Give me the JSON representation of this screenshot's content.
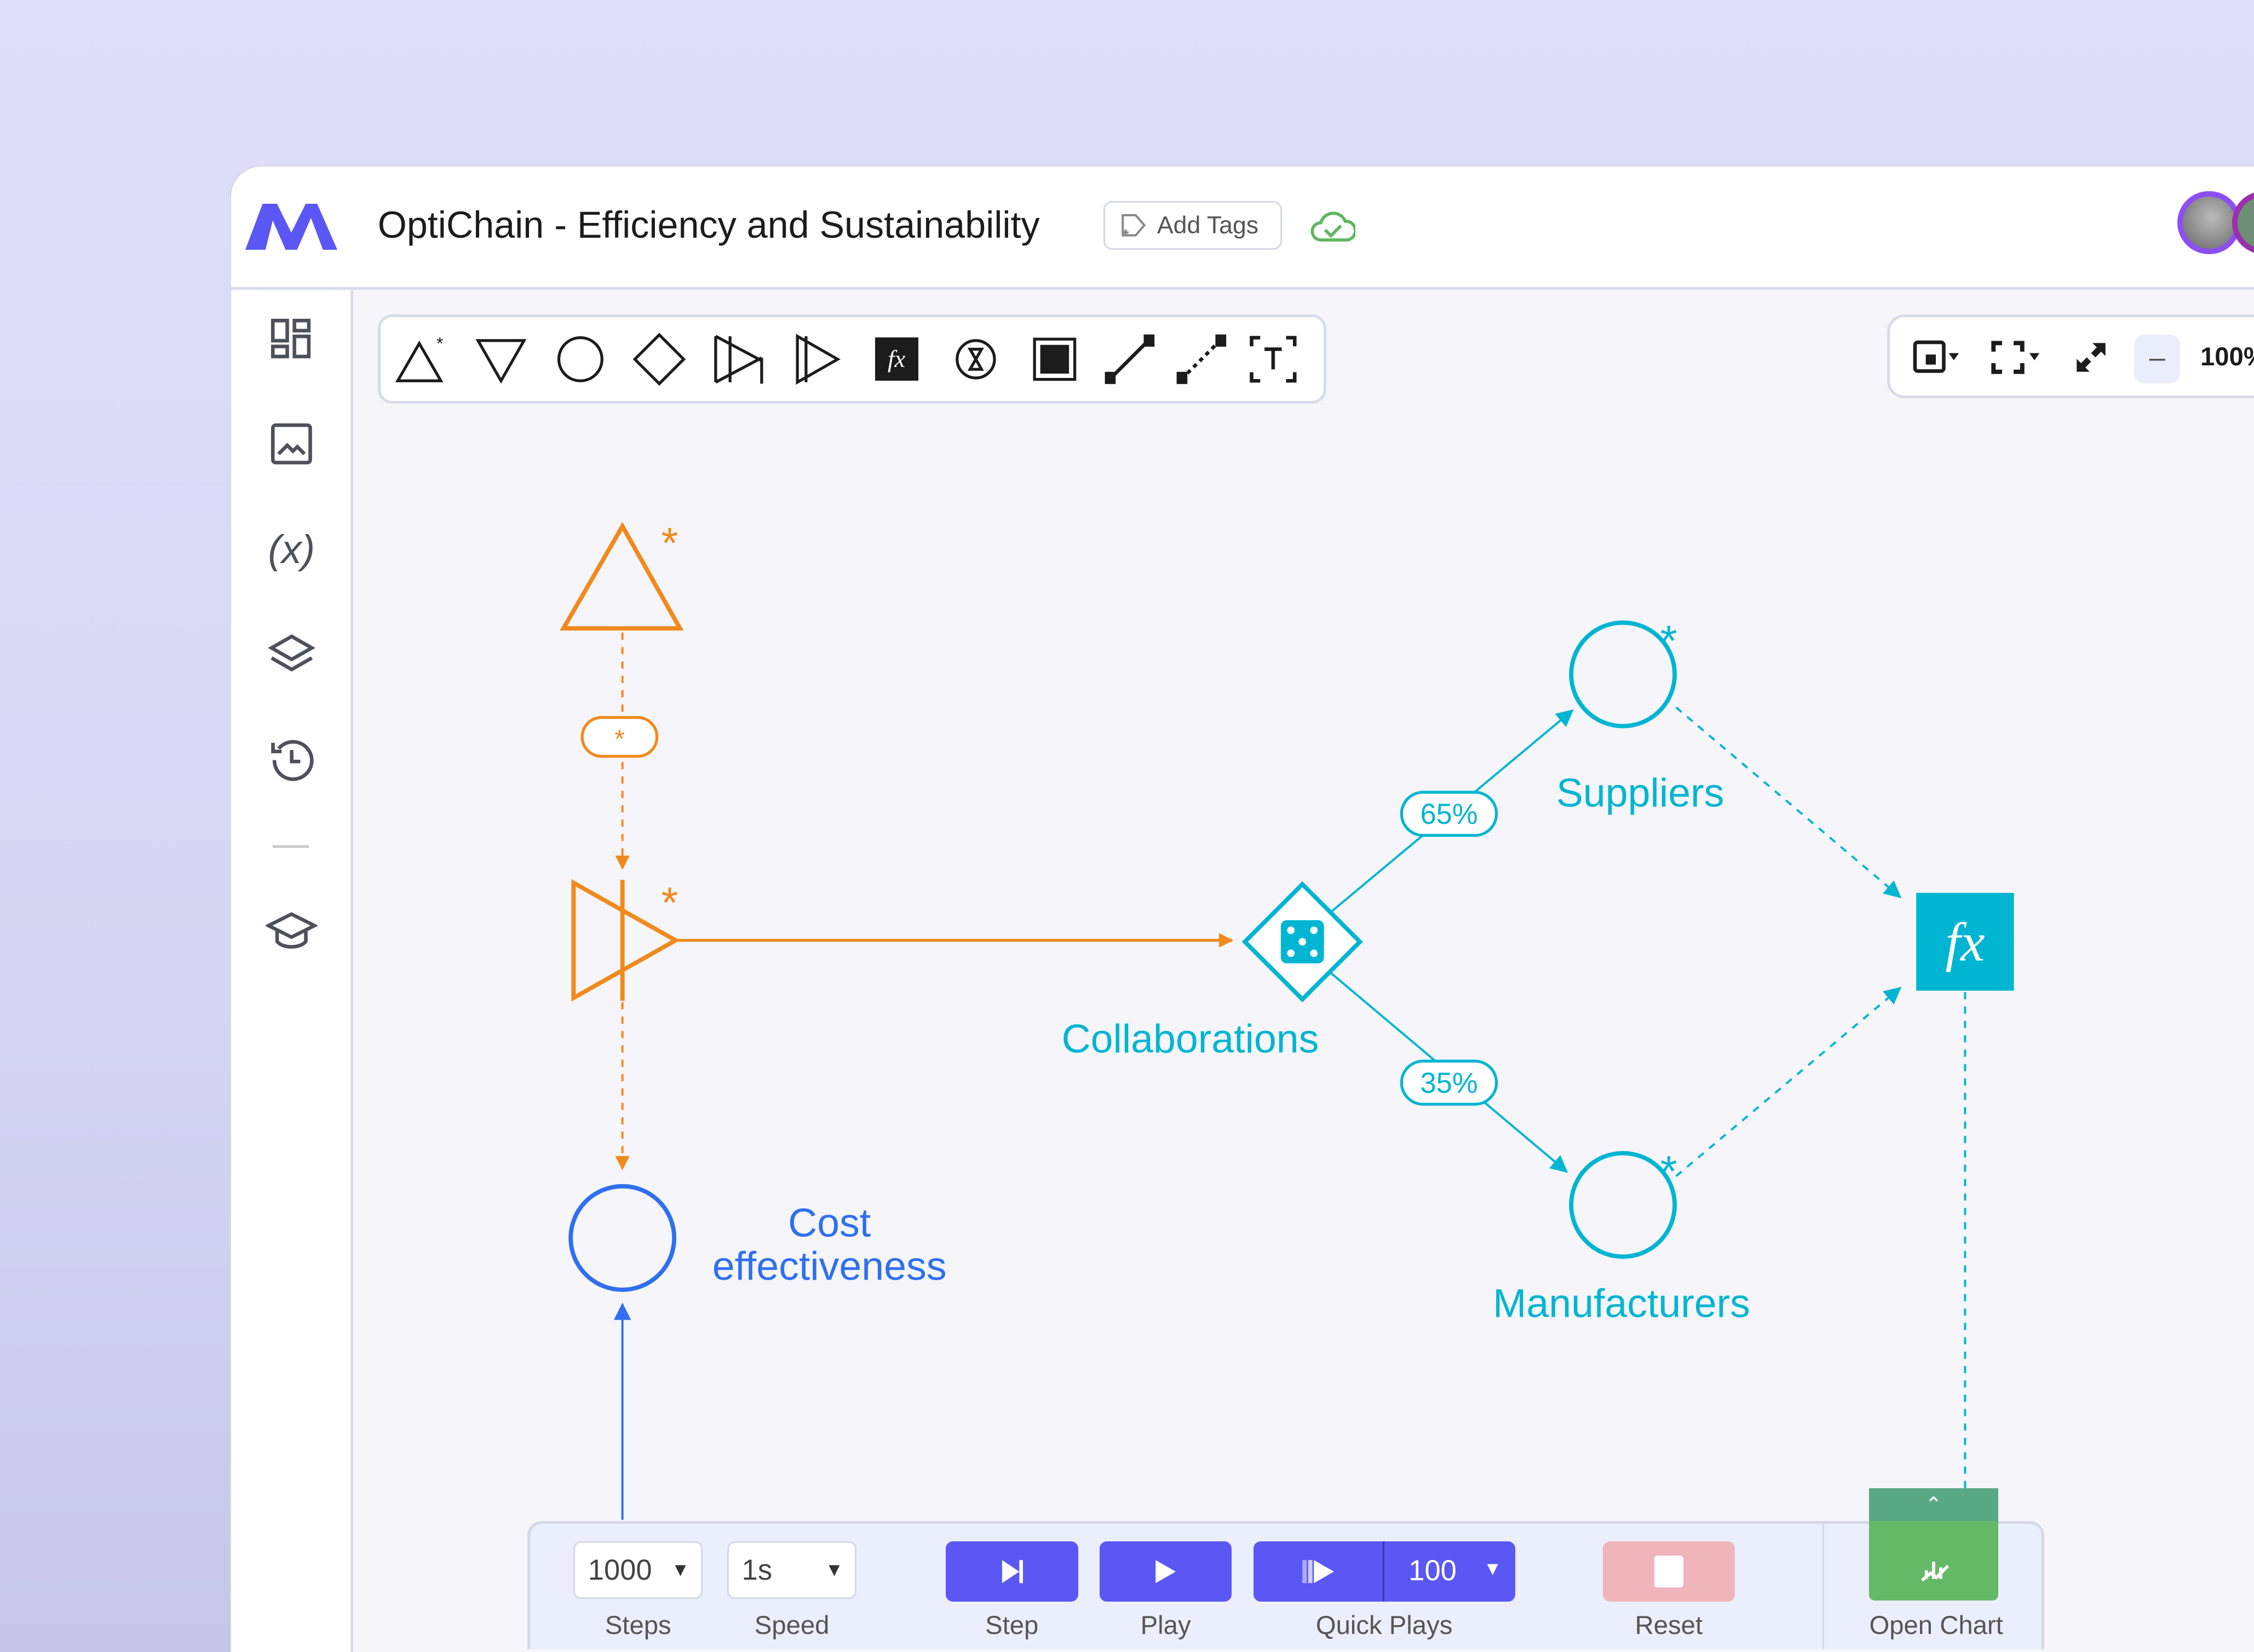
{
  "header": {
    "title": "OptiChain - Efficiency and Sustainability",
    "add_tags_label": "Add Tags",
    "sync_status_icon": "cloud-check-icon"
  },
  "sidebar": {
    "items": [
      {
        "icon": "dashboard-icon"
      },
      {
        "icon": "image-icon"
      },
      {
        "icon": "variables-icon",
        "label": "(x)"
      },
      {
        "icon": "layers-icon"
      },
      {
        "icon": "history-icon"
      },
      {
        "icon": "learn-icon"
      }
    ]
  },
  "toolbar": {
    "tools": [
      "stock-tool",
      "flow-down-tool",
      "variable-tool",
      "decision-tool",
      "converter-tool",
      "delay-tool",
      "function-tool",
      "timer-tool",
      "box-tool",
      "connector-tool",
      "dashed-connector-tool",
      "text-tool"
    ],
    "fx_label": "fx"
  },
  "view": {
    "zoom_label": "100%"
  },
  "diagram": {
    "colors": {
      "orange": "#f08a1c",
      "cyan": "#00b5d2",
      "blue": "#2f6ff0"
    },
    "star": "*",
    "pill_label": "*",
    "cost_label_line1": "Cost",
    "cost_label_line2": "effectiveness",
    "collaborations_label": "Collaborations",
    "suppliers_label": "Suppliers",
    "manufacturers_label": "Manufacturers",
    "pct_suppliers": "65%",
    "pct_manufacturers": "35%",
    "fx_label": "fx"
  },
  "controls": {
    "steps_value": "1000",
    "steps_label": "Steps",
    "speed_value": "1s",
    "speed_label": "Speed",
    "step_label": "Step",
    "play_label": "Play",
    "quick_plays_value": "100",
    "quick_plays_label": "Quick Plays",
    "reset_label": "Reset",
    "open_chart_label": "Open Chart"
  }
}
